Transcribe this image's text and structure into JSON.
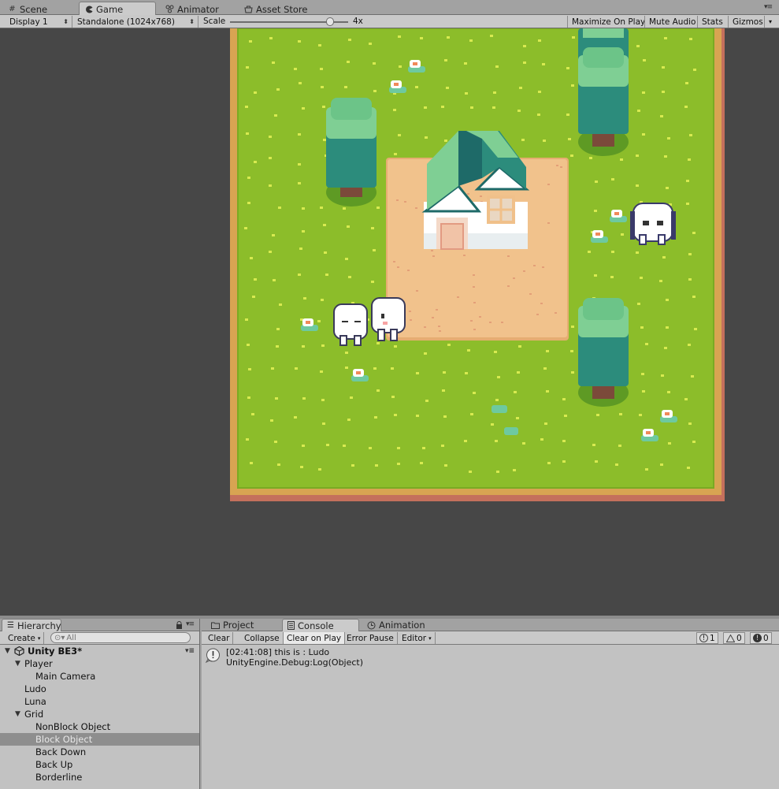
{
  "window": {
    "tabs": [
      {
        "label": "Scene",
        "icon": "grid-icon"
      },
      {
        "label": "Game",
        "icon": "pacman-icon"
      },
      {
        "label": "Animator",
        "icon": "animator-icon"
      },
      {
        "label": "Asset Store",
        "icon": "store-icon"
      }
    ],
    "active_tab": "Game"
  },
  "game_toolbar": {
    "display": "Display 1",
    "resolution": "Standalone (1024x768)",
    "scale_label": "Scale",
    "scale_value": "4x",
    "scale_level": 0.82,
    "maximize": "Maximize On Play",
    "mute": "Mute Audio",
    "stats": "Stats",
    "gizmos": "Gizmos"
  },
  "colors": {
    "grass": "#8cbd2a",
    "border_outer": "#d6a350",
    "border_dark": "#c46a5a",
    "dirt": "#f0c08a",
    "tree_light": "#7fcf94",
    "tree_dark": "#2c8c7c",
    "roof": "#1e6a68",
    "viewport_bg": "#474747"
  },
  "hierarchy": {
    "tab": "Hierarchy",
    "create": "Create",
    "search_placeholder": "All",
    "scene": "Unity BE3*",
    "items": [
      {
        "label": "Player",
        "level": 1,
        "expanded": true
      },
      {
        "label": "Main Camera",
        "level": 2
      },
      {
        "label": "Ludo",
        "level": 1
      },
      {
        "label": "Luna",
        "level": 1
      },
      {
        "label": "Grid",
        "level": 1,
        "expanded": true
      },
      {
        "label": "NonBlock Object",
        "level": 2
      },
      {
        "label": "Block Object",
        "level": 2,
        "selected": true
      },
      {
        "label": "Back Down",
        "level": 2
      },
      {
        "label": "Back Up",
        "level": 2
      },
      {
        "label": "Borderline",
        "level": 2
      }
    ]
  },
  "console": {
    "tabs": [
      {
        "label": "Project",
        "icon": "folder-icon"
      },
      {
        "label": "Console",
        "icon": "console-icon"
      },
      {
        "label": "Animation",
        "icon": "clock-icon"
      }
    ],
    "buttons": {
      "clear": "Clear",
      "collapse": "Collapse",
      "clear_on_play": "Clear on Play",
      "error_pause": "Error Pause",
      "editor": "Editor"
    },
    "counts": {
      "info": "1",
      "warning": "0",
      "error": "0"
    },
    "log": {
      "line1": "[02:41:08] this is : Ludo",
      "line2": "UnityEngine.Debug:Log(Object)"
    }
  }
}
